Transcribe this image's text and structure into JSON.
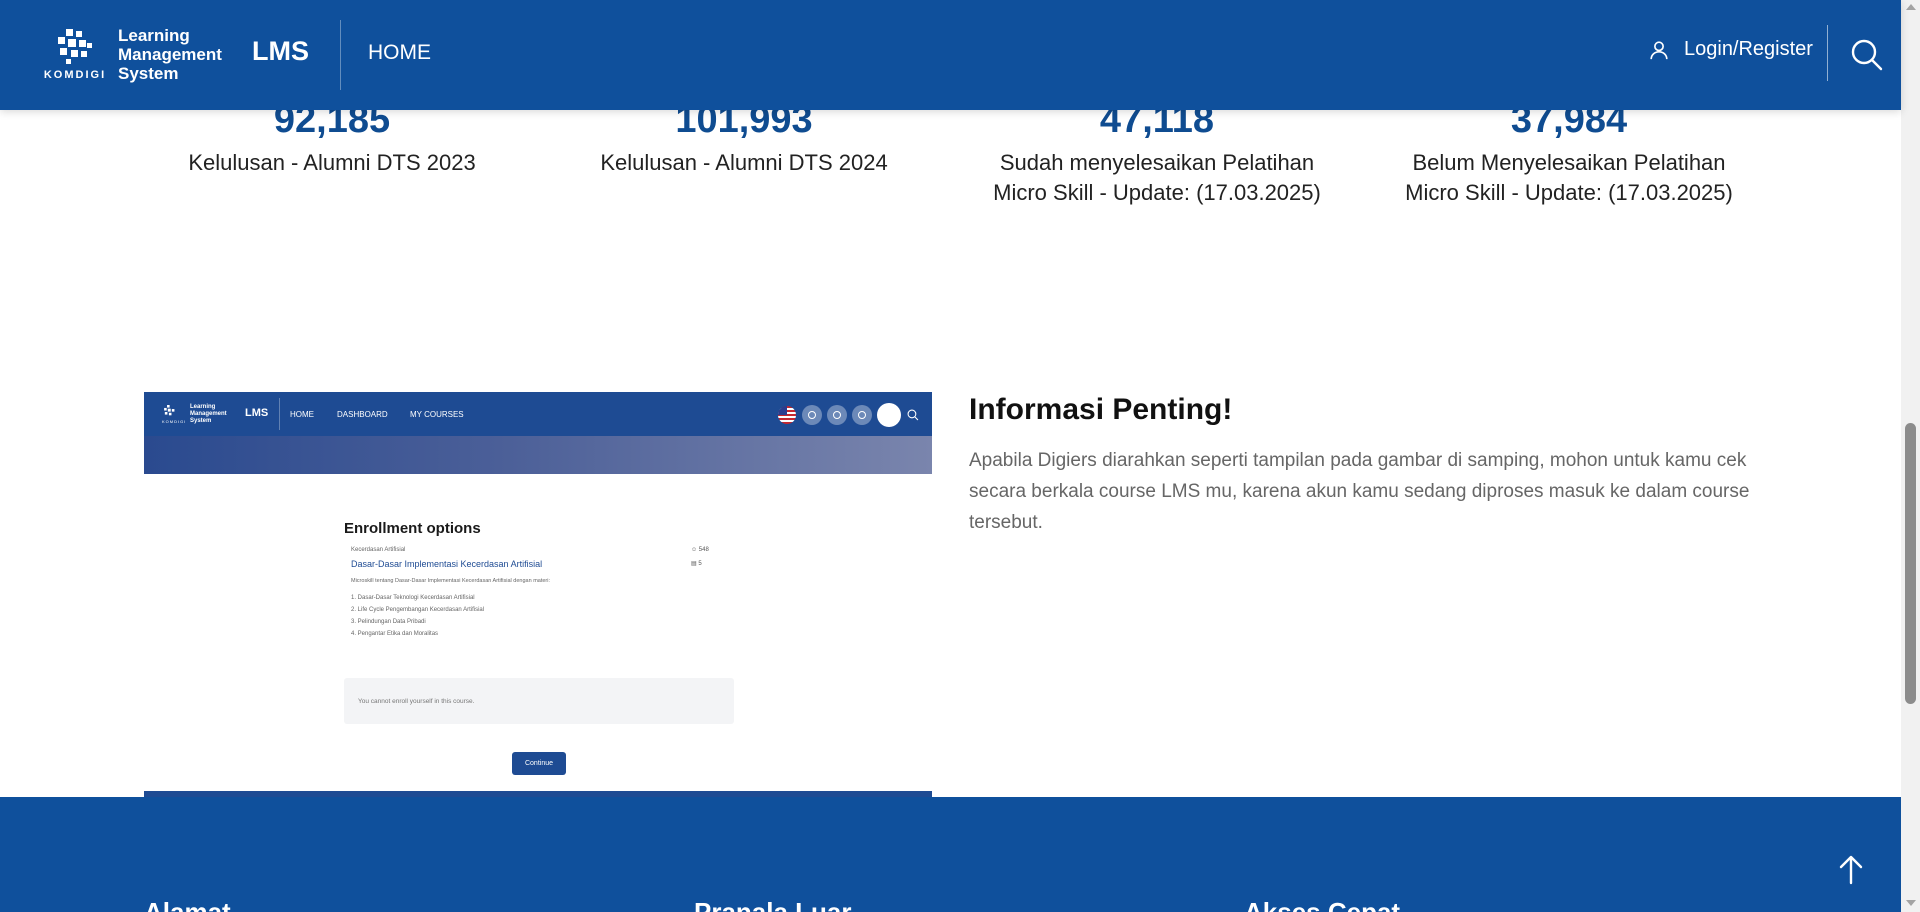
{
  "header": {
    "logo_line1": "Learning",
    "logo_line2": "Management",
    "logo_line3": "System",
    "logo_org": "KOMDIGI",
    "brand": "LMS",
    "nav_home": "HOME",
    "login_label": "Login/Register",
    "icons": [
      "user-icon",
      "search-icon"
    ]
  },
  "stats": [
    {
      "number": "92,185",
      "label": "Kelulusan - Alumni DTS 2023"
    },
    {
      "number": "101,993",
      "label": "Kelulusan - Alumni DTS 2024"
    },
    {
      "number": "47,118",
      "label": "Sudah menyelesaikan Pelatihan Micro Skill - Update: (17.03.2025)"
    },
    {
      "number": "37,984",
      "label": "Belum Menyelesaikan Pelatihan Micro Skill - Update: (17.03.2025)"
    }
  ],
  "screenshot": {
    "logo_line1": "Learning",
    "logo_line2": "Management",
    "logo_line3": "System",
    "logo_org": "KOMDIGI",
    "brand": "LMS",
    "nav_home": "HOME",
    "nav_dashboard": "DASHBOARD",
    "nav_courses": "MY COURSES",
    "title": "Enrollment options",
    "category": "Kecerdasan Artifisial",
    "course_name": "Dasar-Dasar Implementasi Kecerdasan Artifisial",
    "meta_students": "548",
    "meta_modules": "5",
    "description": "Microskill tentang Dasar-Dasar Implementasi Kecerdasan Artifisial dengan materi:",
    "items": [
      "1. Dasar-Dasar Teknologi Kecerdasan Artifisial",
      "2. Life Cycle Pengembangan Kecerdasan Artifisial",
      "3. Pelindungan Data Pribadi",
      "4. Pengantar Etika dan Moralitas"
    ],
    "notice": "You cannot enroll yourself in this course.",
    "continue_button": "Continue"
  },
  "info": {
    "title": "Informasi Penting!",
    "body": "Apabila Digiers diarahkan seperti tampilan pada gambar di samping, mohon untuk kamu cek secara berkala course LMS mu, karena akun kamu sedang diproses masuk ke dalam course tersebut."
  },
  "footer": {
    "col1": "Alamat",
    "col2": "Pranala Luar",
    "col3": "Akses Cepat"
  },
  "colors": {
    "primary": "#0f509c",
    "stat_number": "#0f4c91",
    "body_text": "#666666"
  }
}
